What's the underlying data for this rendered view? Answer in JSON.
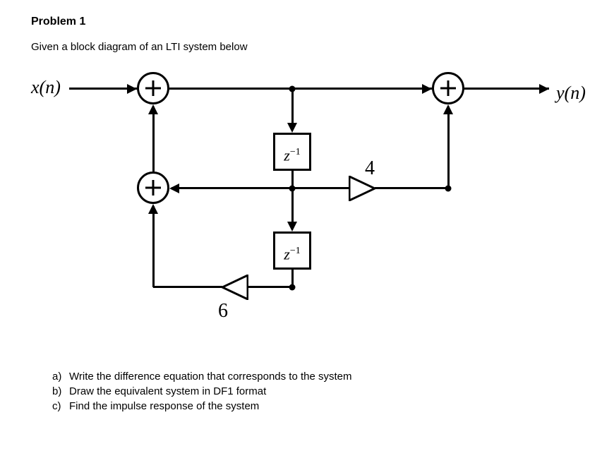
{
  "heading": "Problem 1",
  "prompt": "Given a block diagram of an LTI system below",
  "signals": {
    "input": "x(n)",
    "output": "y(n)"
  },
  "blocks": {
    "delay1": "z",
    "delay1_exp": "−1",
    "delay2": "z",
    "delay2_exp": "−1"
  },
  "gains": {
    "g_upper": "4",
    "g_lower": "6"
  },
  "questions": [
    {
      "label": "a)",
      "text": "Write the difference equation that corresponds to the system"
    },
    {
      "label": "b)",
      "text": "Draw the equivalent system in DF1 format"
    },
    {
      "label": "c)",
      "text": "Find the impulse response of the system"
    }
  ]
}
